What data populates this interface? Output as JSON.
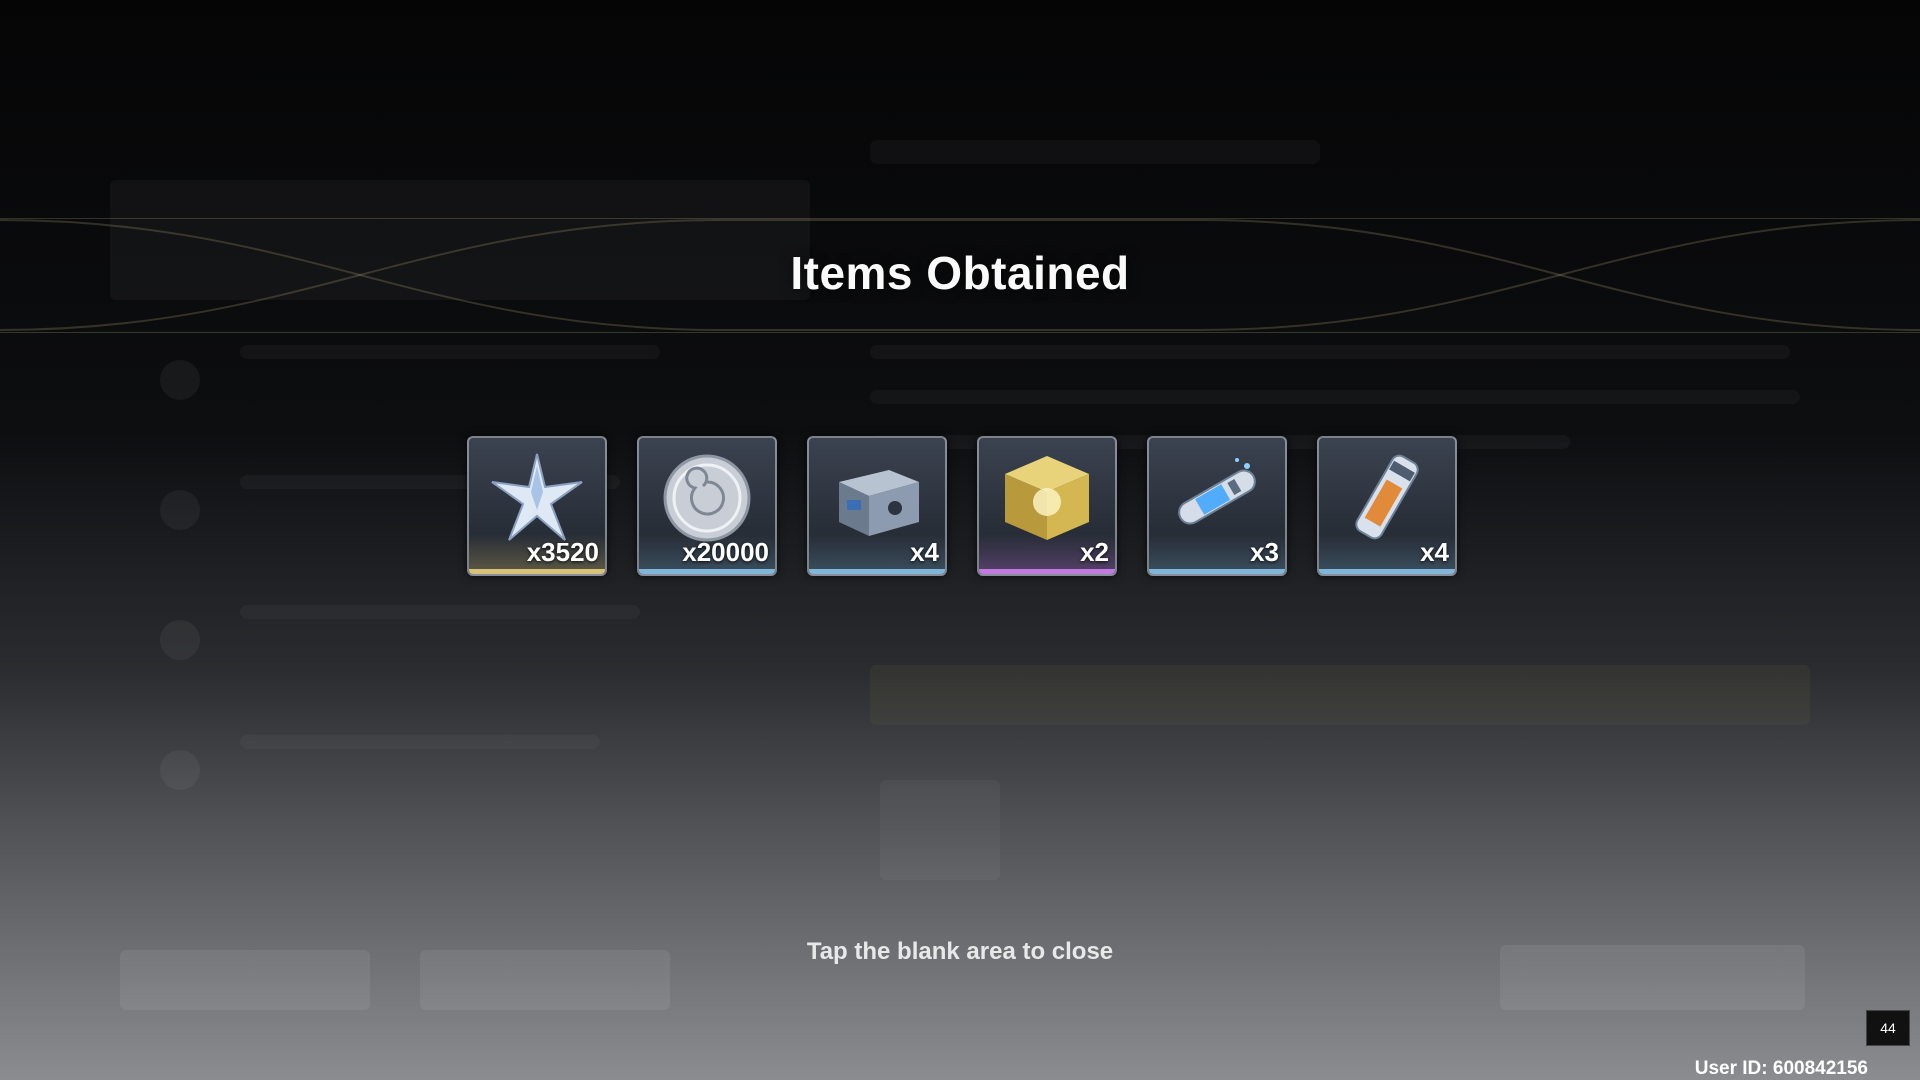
{
  "dialog": {
    "title": "Items Obtained",
    "close_hint": "Tap the blank area to close"
  },
  "items": [
    {
      "quantity": "x3520",
      "icon": "star-crystal-icon",
      "rarity_color": "#d8c27a"
    },
    {
      "quantity": "x20000",
      "icon": "silver-coin-icon",
      "rarity_color": "#7fb6d9"
    },
    {
      "quantity": "x4",
      "icon": "supply-crate-icon",
      "rarity_color": "#7fb6d9"
    },
    {
      "quantity": "x2",
      "icon": "golden-cube-icon",
      "rarity_color": "#c07ae0"
    },
    {
      "quantity": "x3",
      "icon": "energy-capsule-icon",
      "rarity_color": "#7fb6d9"
    },
    {
      "quantity": "x4",
      "icon": "fuel-vial-icon",
      "rarity_color": "#7fb6d9"
    }
  ],
  "overlay": {
    "fps": "44",
    "user_id": "User ID: 600842156"
  }
}
